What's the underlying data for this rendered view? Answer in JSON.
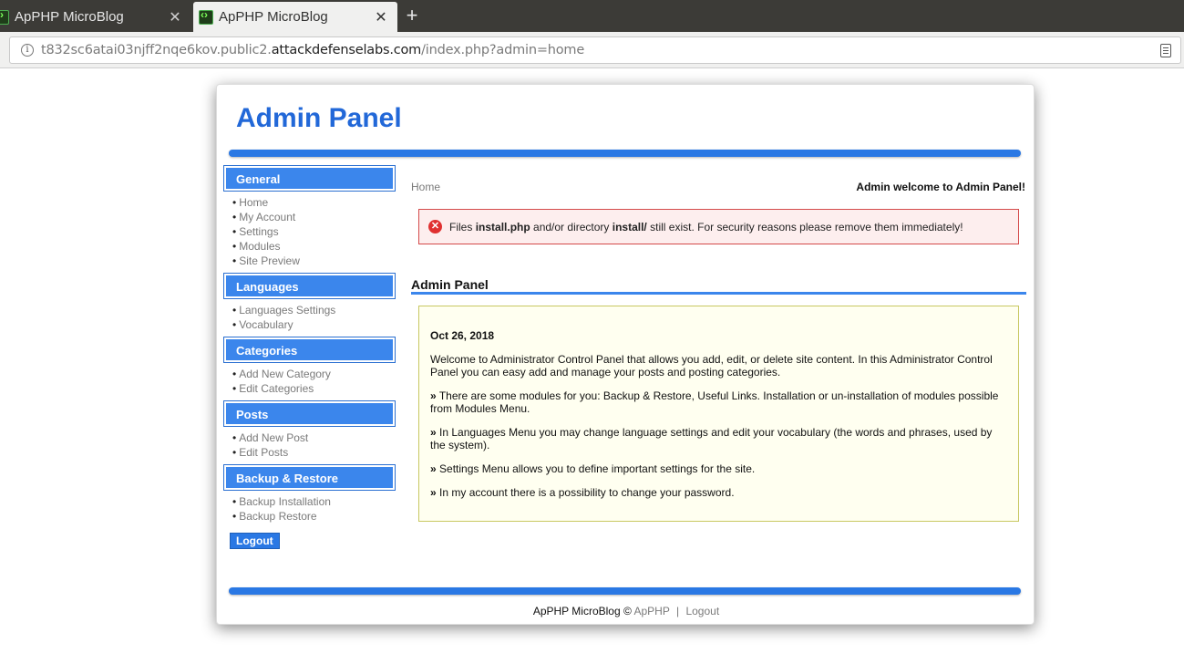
{
  "browser": {
    "tabs": [
      {
        "title": "ApPHP MicroBlog",
        "active": false
      },
      {
        "title": "ApPHP MicroBlog",
        "active": true
      }
    ],
    "url_prefix": "t832sc6atai03njff2nqe6kov.public2.",
    "url_domain": "attackdefenselabs.com",
    "url_path": "/index.php?admin=home"
  },
  "header": {
    "title": "Admin Panel"
  },
  "sidebar": {
    "sections": [
      {
        "title": "General",
        "items": [
          "Home",
          "My Account",
          "Settings",
          "Modules",
          "Site Preview"
        ]
      },
      {
        "title": "Languages",
        "items": [
          "Languages Settings",
          "Vocabulary"
        ]
      },
      {
        "title": "Categories",
        "items": [
          "Add New Category",
          "Edit Categories"
        ]
      },
      {
        "title": "Posts",
        "items": [
          "Add New Post",
          "Edit Posts"
        ]
      },
      {
        "title": "Backup & Restore",
        "items": [
          "Backup Installation",
          "Backup Restore"
        ]
      }
    ],
    "logout_label": "Logout"
  },
  "main": {
    "breadcrumb": "Home",
    "welcome": "Admin welcome to Admin Panel!",
    "alert": {
      "prefix": "Files",
      "file": "install.php",
      "middle": "and/or directory",
      "dir": "install/",
      "suffix": "still exist. For security reasons please remove them immediately!"
    },
    "section_title": "Admin Panel",
    "info": {
      "date": "Oct 26, 2018",
      "intro": "Welcome to Administrator Control Panel that allows you add, edit, or delete site content. In this Administrator Control Panel you can easy add and manage your posts and posting categories.",
      "bullets": [
        "There are some modules for you: Backup & Restore, Useful Links. Installation or un-installation of modules possible from Modules Menu.",
        "In Languages Menu you may change language settings and edit your vocabulary (the words and phrases, used by the system).",
        "Settings Menu allows you to define important settings for the site.",
        "In my account there is a possibility to change your password."
      ]
    }
  },
  "footer": {
    "text": "ApPHP MicroBlog ©",
    "link": "ApPHP",
    "separator": "|",
    "logout": "Logout"
  }
}
